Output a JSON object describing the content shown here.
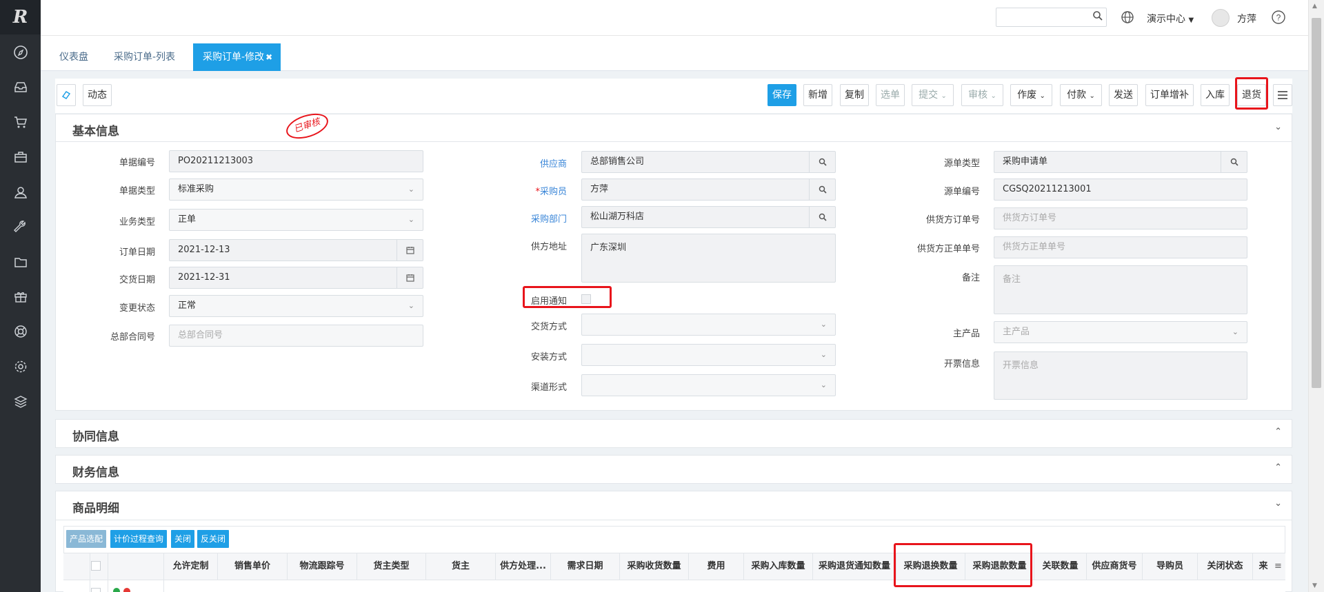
{
  "app": {
    "logo": "R",
    "user": "方萍",
    "menu": "演示中心"
  },
  "sidebar": {
    "icons": [
      "compass-icon",
      "inbox-icon",
      "cart-icon",
      "briefcase-icon",
      "user-icon",
      "wrench-icon",
      "folder-icon",
      "gift-icon",
      "lifebuoy-icon",
      "settings-icon",
      "layers-icon"
    ]
  },
  "tabs": [
    {
      "label": "仪表盘"
    },
    {
      "label": "采购订单-列表"
    },
    {
      "label": "采购订单-修改",
      "close": "✖"
    }
  ],
  "toolbar": {
    "log": "动态",
    "buttons": [
      "保存",
      "新增",
      "复制",
      "选单",
      "提交",
      "审核",
      "作废",
      "付款",
      "发送",
      "订单增补",
      "入库",
      "退货"
    ]
  },
  "stamp": "已审核",
  "sections": {
    "basic": "基本信息",
    "collab": "协同信息",
    "finance": "财务信息",
    "goods": "商品明细"
  },
  "form": {
    "order_no": {
      "label": "单据编号",
      "value": "PO20211213003"
    },
    "doc_type": {
      "label": "单据类型",
      "value": "标准采购"
    },
    "biz_type": {
      "label": "业务类型",
      "value": "正单"
    },
    "order_date": {
      "label": "订单日期",
      "value": "2021-12-13"
    },
    "delivery_date": {
      "label": "交货日期",
      "value": "2021-12-31"
    },
    "change_status": {
      "label": "变更状态",
      "value": "正常"
    },
    "hq_contract": {
      "label": "总部合同号",
      "placeholder": "总部合同号"
    },
    "supplier": {
      "label": "供应商",
      "value": "总部销售公司"
    },
    "buyer": {
      "label": "采购员",
      "required": "*",
      "value": "方萍"
    },
    "dept": {
      "label": "采购部门",
      "value": "松山湖万科店"
    },
    "supplier_addr": {
      "label": "供方地址",
      "value": "广东深圳"
    },
    "notify": {
      "label": "启用通知"
    },
    "delivery_method": {
      "label": "交货方式",
      "value": ""
    },
    "install_method": {
      "label": "安装方式",
      "value": ""
    },
    "channel": {
      "label": "渠道形式",
      "value": ""
    },
    "source_type": {
      "label": "源单类型",
      "value": "采购申请单"
    },
    "source_no": {
      "label": "源单编号",
      "value": "CGSQ20211213001"
    },
    "supplier_order": {
      "label": "供货方订单号",
      "placeholder": "供货方订单号"
    },
    "supplier_formal": {
      "label": "供货方正单单号",
      "placeholder": "供货方正单单号"
    },
    "remark": {
      "label": "备注",
      "placeholder": "备注"
    },
    "main_product": {
      "label": "主产品",
      "placeholder": "主产品"
    },
    "invoice": {
      "label": "开票信息",
      "placeholder": "开票信息"
    }
  },
  "grid": {
    "buttons": [
      "产品选配",
      "计价过程查询",
      "关闭",
      "反关闭"
    ],
    "columns": [
      "允许定制",
      "销售单价",
      "物流跟踪号",
      "货主类型",
      "货主",
      "供方处理...",
      "需求日期",
      "采购收货数量",
      "费用",
      "采购入库数量",
      "采购退货通知数量",
      "采购退换数量",
      "采购退款数量",
      "关联数量",
      "供应商货号",
      "导购员",
      "关闭状态",
      "来"
    ]
  }
}
